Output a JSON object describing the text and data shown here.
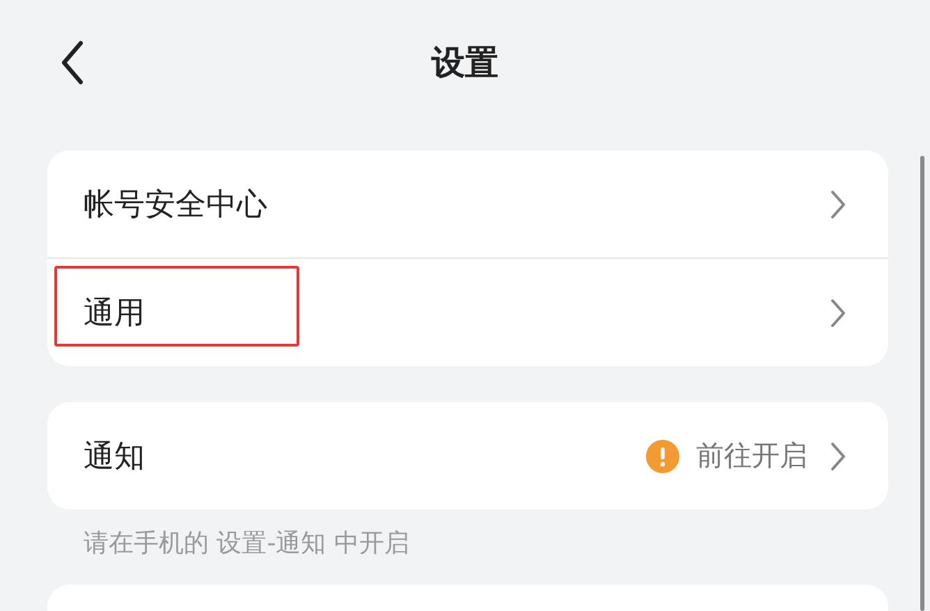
{
  "header": {
    "title": "设置"
  },
  "groups": [
    {
      "rows": [
        {
          "label": "帐号安全中心",
          "highlighted": false
        },
        {
          "label": "通用",
          "highlighted": true
        }
      ]
    },
    {
      "rows": [
        {
          "label": "通知",
          "highlighted": false,
          "status": "前往开启",
          "warning": true
        }
      ],
      "hint": "请在手机的 设置-通知 中开启"
    }
  ]
}
